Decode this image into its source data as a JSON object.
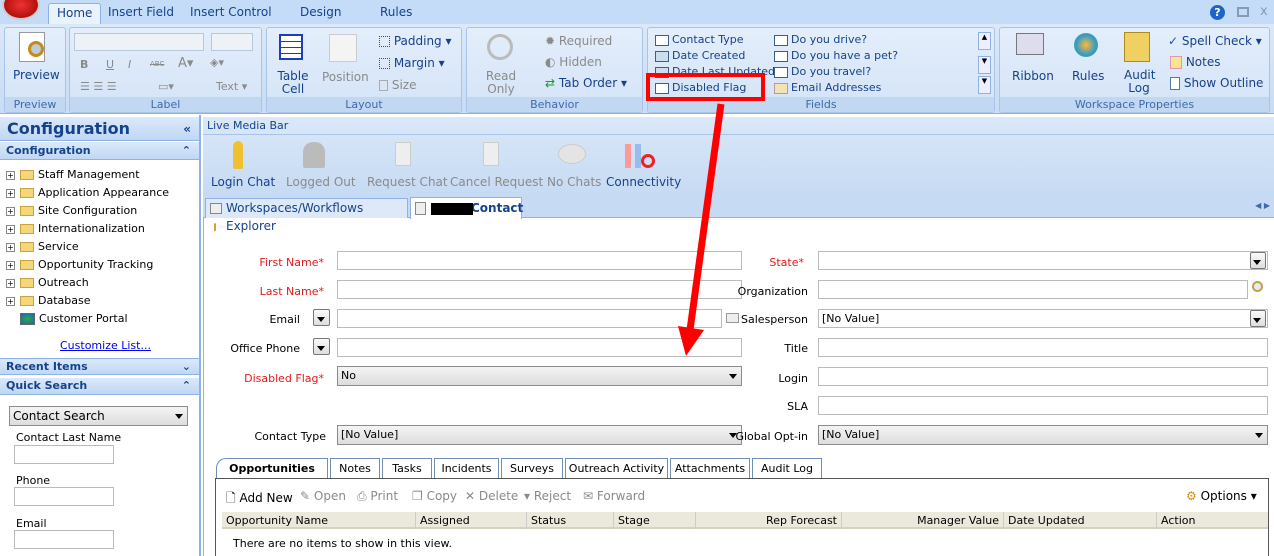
{
  "ribbon_tabs": [
    "Home",
    "Insert Field",
    "Insert Control",
    "Design",
    "Rules"
  ],
  "ribbon": {
    "preview": {
      "button": "Preview",
      "group": "Preview"
    },
    "label": {
      "group": "Label",
      "bold": "B",
      "underline": "U",
      "italic": "I",
      "strike": "ABC",
      "text": "Text"
    },
    "layout": {
      "group": "Layout",
      "table_cell": "Table Cell",
      "position": "Position",
      "padding": "Padding",
      "margin": "Margin",
      "size": "Size"
    },
    "behavior": {
      "group": "Behavior",
      "read_only": "Read Only",
      "required": "Required",
      "hidden": "Hidden",
      "tab_order": "Tab Order"
    },
    "fields": {
      "group": "Fields",
      "items": [
        "Contact Type",
        "Date Created",
        "Date Last Updated",
        "Disabled Flag",
        "Do you drive?",
        "Do you have a pet?",
        "Do you travel?",
        "Email Addresses"
      ]
    },
    "workspace": {
      "group": "Workspace Properties",
      "ribbon": "Ribbon",
      "rules": "Rules",
      "audit_log": "Audit Log",
      "spell_check": "Spell Check",
      "notes": "Notes",
      "show_outline": "Show Outline"
    }
  },
  "left": {
    "title": "Configuration",
    "section": "Configuration",
    "tree": [
      "Staff Management",
      "Application Appearance",
      "Site Configuration",
      "Internationalization",
      "Service",
      "Opportunity Tracking",
      "Outreach",
      "Database"
    ],
    "portal": "Customer Portal",
    "customize": "Customize List...",
    "recent": "Recent Items",
    "quick_search": "Quick Search",
    "search_type": "Contact Search",
    "fields": [
      "Contact Last Name",
      "Phone",
      "Email"
    ]
  },
  "media_bar": {
    "title": "Live Media Bar",
    "buttons": [
      "Login Chat",
      "Logged Out",
      "Request Chat",
      "Cancel Request",
      "No Chats",
      "Connectivity"
    ]
  },
  "doc_tabs": [
    "Workspaces/Workflows Explorer",
    "Contact"
  ],
  "form": {
    "left": [
      {
        "label": "First Name*",
        "value": ""
      },
      {
        "label": "Last Name*",
        "value": ""
      },
      {
        "label": "Email",
        "value": ""
      },
      {
        "label": "Office Phone",
        "value": ""
      },
      {
        "label": "Disabled Flag*",
        "value": "No"
      },
      {
        "label": "Contact Type",
        "value": "[No Value]"
      }
    ],
    "right": [
      {
        "label": "State*",
        "value": ""
      },
      {
        "label": "Organization",
        "value": ""
      },
      {
        "label": "Salesperson",
        "value": "[No Value]"
      },
      {
        "label": "Title",
        "value": ""
      },
      {
        "label": "Login",
        "value": ""
      },
      {
        "label": "SLA",
        "value": ""
      },
      {
        "label": "Global Opt-in",
        "value": "[No Value]"
      }
    ]
  },
  "bottom_tabs": [
    "Opportunities",
    "Notes",
    "Tasks",
    "Incidents",
    "Surveys",
    "Outreach Activity",
    "Attachments",
    "Audit Log"
  ],
  "grid_toolbar": [
    "Add New",
    "Open",
    "Print",
    "Copy",
    "Delete",
    "Reject",
    "Forward"
  ],
  "options": "Options",
  "columns": [
    "Opportunity Name",
    "Assigned",
    "Status",
    "Stage",
    "Rep Forecast",
    "Manager Value",
    "Date Updated",
    "Action"
  ],
  "empty_text": "There are no items to show in this view.",
  "annotation_color": "#ff0000"
}
